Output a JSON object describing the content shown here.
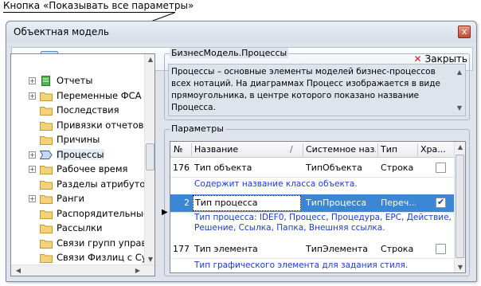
{
  "callout": {
    "text": "Кнопка «Показывать все параметры»"
  },
  "window": {
    "title": "Объектная модель",
    "close_glyph": "x"
  },
  "toolbar": {
    "close_label": "Закрыть",
    "close_glyph": "✕"
  },
  "tree": {
    "items": [
      {
        "label": "Отчеты",
        "icon": "report-icon",
        "expander": true
      },
      {
        "label": "Переменные ФСА",
        "icon": "folder-icon",
        "expander": true
      },
      {
        "label": "Последствия",
        "icon": "folder-icon",
        "expander": false
      },
      {
        "label": "Привязки отчетов",
        "icon": "folder-icon",
        "expander": false
      },
      {
        "label": "Причины",
        "icon": "folder-icon",
        "expander": false
      },
      {
        "label": "Процессы",
        "icon": "process-icon",
        "expander": true,
        "selected": true
      },
      {
        "label": "Рабочее время",
        "icon": "folder-icon",
        "expander": true
      },
      {
        "label": "Разделы атрибутов",
        "icon": "folder-icon",
        "expander": false
      },
      {
        "label": "Ранги",
        "icon": "folder-icon",
        "expander": true
      },
      {
        "label": "Распорядительные",
        "icon": "folder-icon",
        "expander": false
      },
      {
        "label": "Рассылки",
        "icon": "folder-icon",
        "expander": false
      },
      {
        "label": "Связи групп управ",
        "icon": "folder-icon",
        "expander": false
      },
      {
        "label": "Связи Физлиц с Су",
        "icon": "folder-icon",
        "expander": false
      }
    ]
  },
  "description": {
    "group_title": "БизнесМодель.Процессы",
    "text": "Процессы – основные элементы моделей бизнес-процессов всех нотаций. На диаграммах Процесс изображается в виде прямоугольника, в центре которого показано название Процесса."
  },
  "params": {
    "group_title": "Параметры",
    "columns": {
      "num": "№",
      "name": "Название",
      "sort_glyph": "/",
      "system_name": "Системное наз...",
      "type": "Тип",
      "stored": "Хра..."
    },
    "rows": [
      {
        "num": "176",
        "name": "Тип объекта",
        "system_name": "ТипОбъекта",
        "type": "Строка",
        "stored": false,
        "description": [
          "Содержит название класса объекта."
        ]
      },
      {
        "num": "2",
        "name": "Тип процесса",
        "system_name": "ТипПроцесса",
        "type": "Переч...",
        "stored": true,
        "selected": true,
        "description": [
          "Тип процесса: IDEF0, Процесс, Процедура, EPC, Действие,",
          "Решение, Ссылка, Папка, Внешняя ссылка."
        ]
      },
      {
        "num": "177",
        "name": "Тип элемента",
        "system_name": "ТипЭлемента",
        "type": "Строка",
        "stored": false,
        "description": [
          "Тип графического элемента для задания стиля."
        ]
      }
    ]
  },
  "colors": {
    "window_bg": "#dfe4ec",
    "selection": "#3c86d6",
    "desc_text": "#1a3ad8",
    "close_red": "#d42020"
  }
}
